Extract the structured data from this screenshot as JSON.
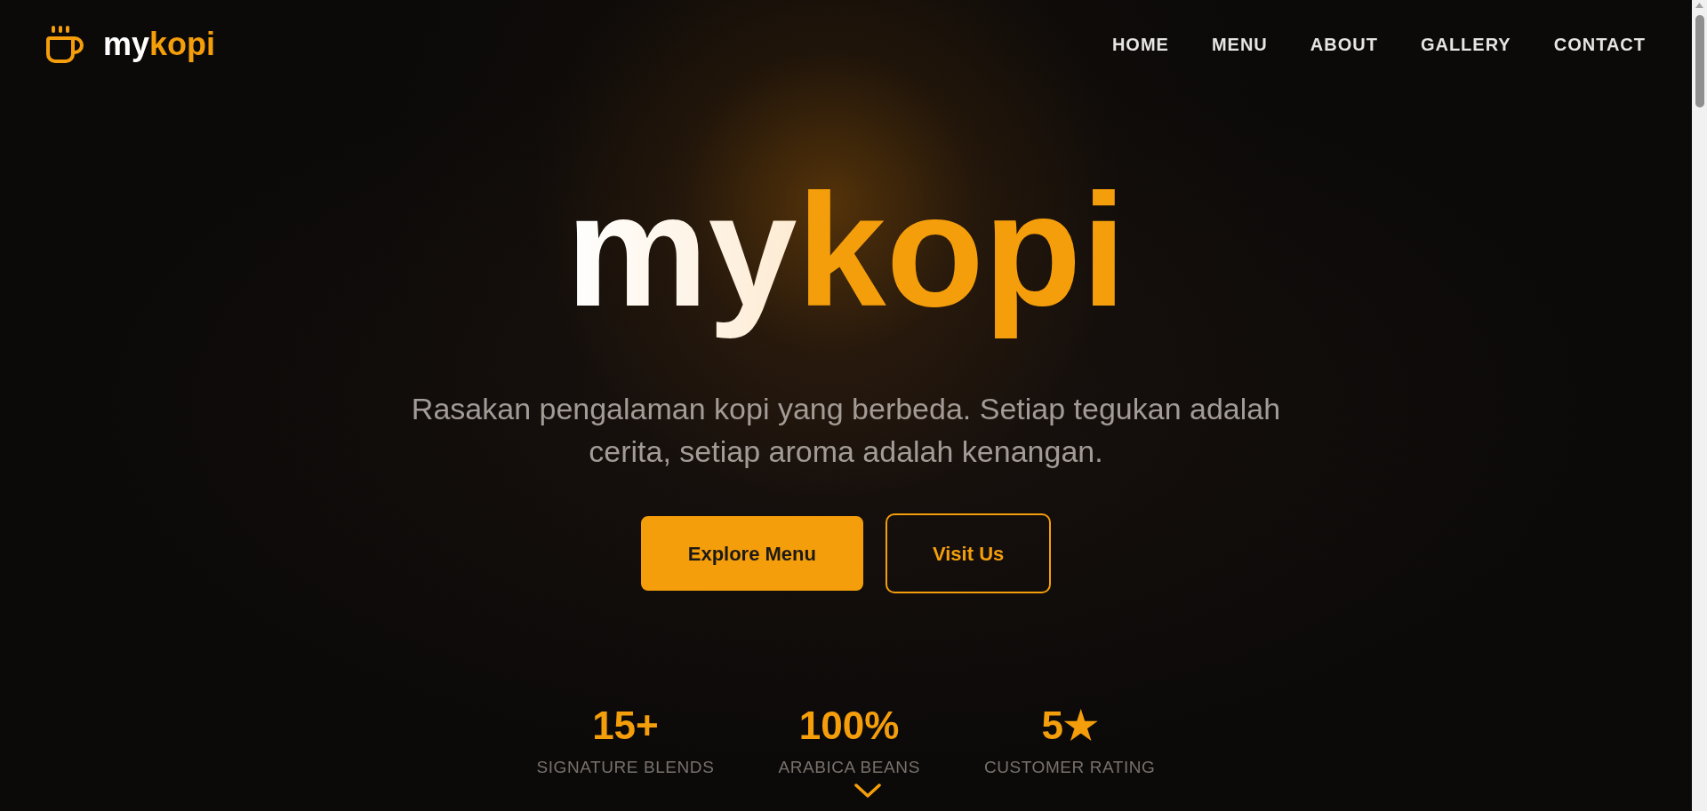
{
  "logo": {
    "text_main": "my",
    "text_accent": "kopi"
  },
  "nav": {
    "items": [
      {
        "label": "HOME"
      },
      {
        "label": "MENU"
      },
      {
        "label": "ABOUT"
      },
      {
        "label": "GALLERY"
      },
      {
        "label": "CONTACT"
      }
    ]
  },
  "hero": {
    "title_main": "my",
    "title_accent": "kopi",
    "subtitle": "Rasakan pengalaman kopi yang berbeda. Setiap tegukan adalah cerita, setiap aroma adalah kenangan.",
    "buttons": [
      {
        "label": "Explore Menu",
        "kind": "primary"
      },
      {
        "label": "Visit Us",
        "kind": "outline"
      }
    ]
  },
  "stats": [
    {
      "value": "15+",
      "label": "SIGNATURE BLENDS"
    },
    {
      "value": "100%",
      "label": "ARABICA BEANS"
    },
    {
      "value": "5★",
      "label": "CUSTOMER RATING"
    }
  ]
}
